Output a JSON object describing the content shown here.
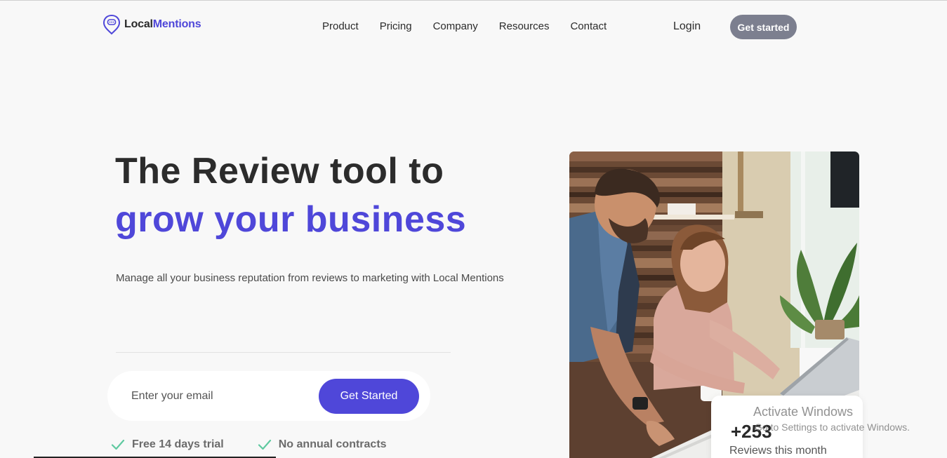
{
  "header": {
    "logo_part1": "Local",
    "logo_part2": "Mentions",
    "nav": [
      "Product",
      "Pricing",
      "Company",
      "Resources",
      "Contact"
    ],
    "login": "Login",
    "cta": "Get started"
  },
  "hero": {
    "headline_line1": "The Review tool to",
    "headline_line2": "grow your business",
    "subtext": "Manage all your business reputation from reviews to marketing with Local Mentions",
    "email_placeholder": "Enter your email",
    "email_button": "Get Started",
    "features": [
      "Free 14 days trial",
      "No annual contracts"
    ]
  },
  "stat_card": {
    "value": "+253",
    "label": "Reviews this month"
  },
  "watermark": {
    "title": "Activate Windows",
    "subtitle": "Go to Settings to activate Windows."
  },
  "colors": {
    "brand": "#4f47d9",
    "header_cta": "#7c7f8f",
    "check": "#5fc9a0",
    "background": "#f8f8f8"
  },
  "icons": {
    "logo": "speech-bubble-pin-icon",
    "feature": "check-icon"
  }
}
